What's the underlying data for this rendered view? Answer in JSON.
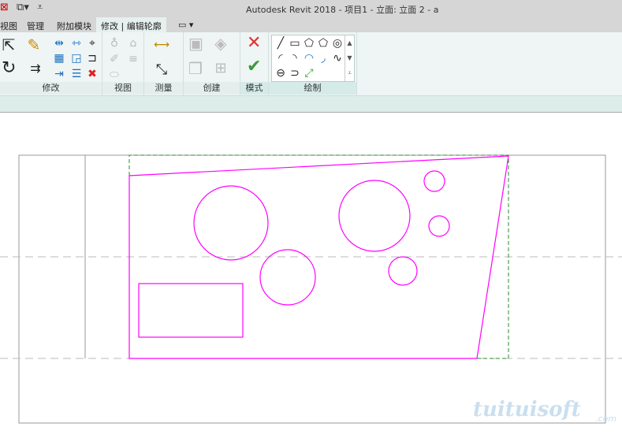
{
  "window": {
    "title": "Autodesk Revit 2018 -     项目1 - 立面: 立面 2 - a"
  },
  "quick_access": {
    "icons": [
      "close-project-icon",
      "switch-windows-icon",
      "dropdown-icon"
    ]
  },
  "tabs": [
    {
      "label": "视图"
    },
    {
      "label": "管理"
    },
    {
      "label": "附加模块"
    },
    {
      "label": "修改 | 编辑轮廓",
      "active": true
    },
    {
      "label": "▭ ▾"
    }
  ],
  "panels": {
    "modify": "修改",
    "view": "视图",
    "measure": "测量",
    "create": "创建",
    "mode": "模式",
    "draw": "绘制"
  },
  "mode": {
    "cancel": "✕",
    "finish": "✔"
  },
  "colors": {
    "sketch": "#ff00ff",
    "reference": "#2e8b2e",
    "ribbon": "#eef5f4"
  },
  "watermark": {
    "text": "tuituisoft",
    "suffix": ".com"
  }
}
